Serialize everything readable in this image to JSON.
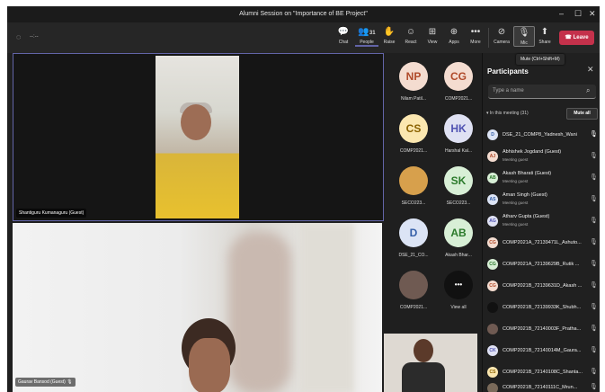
{
  "window": {
    "title": "Alumni Session on \"Importance of BE Project\"",
    "controls": [
      "–",
      "☐",
      "✕"
    ]
  },
  "toolbar": {
    "left_status": "◌",
    "left_timer": "--:--",
    "buttons": [
      {
        "label": "Chat",
        "icon": "chat-icon",
        "glyph": "💬"
      },
      {
        "label": "People",
        "icon": "people-icon",
        "glyph": "👥",
        "badge": "31"
      },
      {
        "label": "Raise",
        "icon": "raise-hand-icon",
        "glyph": "✋"
      },
      {
        "label": "React",
        "icon": "react-icon",
        "glyph": "☺"
      },
      {
        "label": "View",
        "icon": "view-icon",
        "glyph": "⊞"
      },
      {
        "label": "Apps",
        "icon": "apps-icon",
        "glyph": "⊕"
      },
      {
        "label": "More",
        "icon": "more-icon",
        "glyph": "•••"
      },
      {
        "label": "Camera",
        "icon": "camera-off-icon",
        "glyph": "⊘"
      },
      {
        "label": "Mic",
        "icon": "mic-icon",
        "glyph": "🎙"
      },
      {
        "label": "Share",
        "icon": "share-icon",
        "glyph": "⬆"
      }
    ],
    "leave_label": "Leave"
  },
  "tooltip": "Mute (Ctrl+Shift+M)",
  "stage": {
    "main_video_name": "Shantiguru Kumanaguru (Guest)",
    "second_video_name": "Gaurav Bansod (Guest)",
    "tiles": [
      {
        "initials": "NP",
        "label": "Nilam Patil...",
        "bg": "#f4dcd0",
        "fg": "#b04a2a"
      },
      {
        "initials": "CG",
        "label": "COMP2021...",
        "bg": "#f4dcd0",
        "fg": "#b04a2a"
      },
      {
        "initials": "CS",
        "label": "COMP2021...",
        "bg": "#fbe7b0",
        "fg": "#8a6100"
      },
      {
        "initials": "HK",
        "label": "Harshal Kal...",
        "bg": "#dfe1f3",
        "fg": "#4f52b2"
      },
      {
        "initials": "",
        "label": "SECO223...",
        "bg": "#d7a04c",
        "fg": "#ffffff"
      },
      {
        "initials": "SK",
        "label": "SECO223...",
        "bg": "#d8efd6",
        "fg": "#2b7a2b"
      },
      {
        "initials": "D",
        "label": "DSE_21_CO...",
        "bg": "#dce4f5",
        "fg": "#355fa8"
      },
      {
        "initials": "AB",
        "label": "Akash Bhar...",
        "bg": "#d8efd6",
        "fg": "#2b7a2b"
      },
      {
        "initials": "",
        "label": "COMP2021...",
        "bg": "#6f5a52",
        "fg": "#ffffff"
      },
      {
        "initials": "•••",
        "label": "View all",
        "bg": "#111111",
        "fg": "#ffffff"
      }
    ]
  },
  "participants": {
    "title": "Participants",
    "search_placeholder": "Type a name",
    "section_label": "In this meeting (31)",
    "mute_all_label": "Mute all",
    "list": [
      {
        "initials": "D",
        "name": "DSE_21_COMP8_Yadnesh_Wani",
        "sub": "",
        "bg": "#dce4f5",
        "fg": "#355fa8"
      },
      {
        "initials": "AJ",
        "name": "Abhishek Jogdand (Guest)",
        "sub": "Meeting guest",
        "bg": "#f4dcd0",
        "fg": "#b04a2a"
      },
      {
        "initials": "AB",
        "name": "Akash Bharati (Guest)",
        "sub": "Meeting guest",
        "bg": "#d8efd6",
        "fg": "#2b7a2b"
      },
      {
        "initials": "AS",
        "name": "Aman Singh (Guest)",
        "sub": "Meeting guest",
        "bg": "#dce4f5",
        "fg": "#355fa8"
      },
      {
        "initials": "AG",
        "name": "Atharv Gupta (Guest)",
        "sub": "Meeting guest",
        "bg": "#dfe1f3",
        "fg": "#4f52b2"
      },
      {
        "initials": "CG",
        "name": "COMP2021A_72139471L_Ashuto...",
        "sub": "",
        "bg": "#f4dcd0",
        "fg": "#b04a2a"
      },
      {
        "initials": "CG",
        "name": "COMP2021A_72139629B_Rutik ...",
        "sub": "",
        "bg": "#d8efd6",
        "fg": "#2b7a2b"
      },
      {
        "initials": "CG",
        "name": "COMP2021B_72139631D_Akash ...",
        "sub": "",
        "bg": "#f4dcd0",
        "fg": "#b04a2a"
      },
      {
        "initials": "",
        "name": "COMP2021B_72139933K_Shubh...",
        "sub": "",
        "bg": "#111111",
        "fg": "#ffffff"
      },
      {
        "initials": "",
        "name": "COMP2021B_72140003F_Pratha...",
        "sub": "",
        "bg": "#6f5a52",
        "fg": "#ffffff"
      },
      {
        "initials": "CK",
        "name": "COMP2021B_72140014M_Gaura...",
        "sub": "",
        "bg": "#dfe1f3",
        "fg": "#4f52b2"
      },
      {
        "initials": "CS",
        "name": "COMP2021B_72140108C_Shanta...",
        "sub": "",
        "bg": "#fbe7b0",
        "fg": "#8a6100"
      },
      {
        "initials": "",
        "name": "COMP2021B_72140111C_Mrun...",
        "sub": "",
        "bg": "#7a6a5a",
        "fg": "#ffffff"
      }
    ]
  },
  "colors": {
    "accent": "#6264a7",
    "leave": "#c4314b"
  }
}
